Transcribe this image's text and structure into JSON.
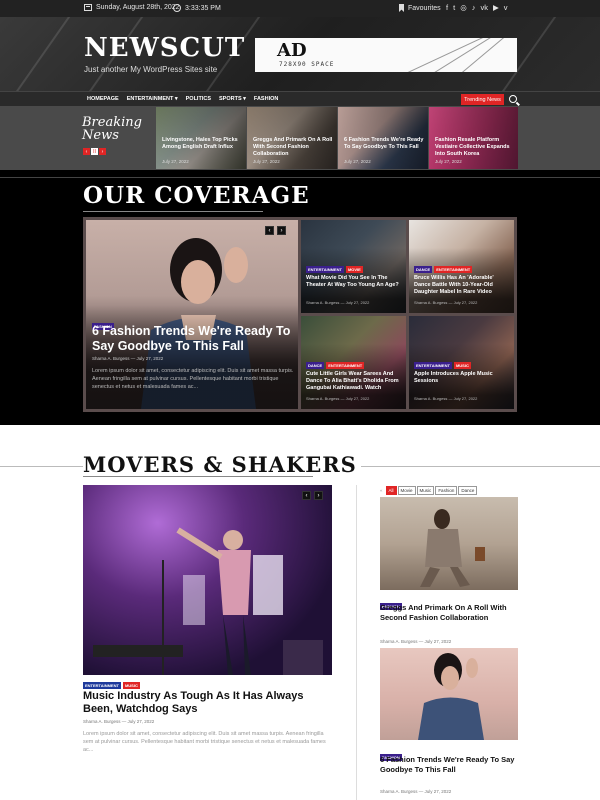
{
  "topbar": {
    "date": "Sunday, August 28th, 2022",
    "time": "3:33:35 PM",
    "favourites": "Favourites",
    "social_icons": [
      "facebook-icon",
      "twitter-icon",
      "instagram-icon",
      "tiktok-icon",
      "vk-icon",
      "youtube-icon",
      "vimeo-icon"
    ],
    "social_glyphs": [
      "f",
      "t",
      "◎",
      "♪",
      "vk",
      "▶",
      "v"
    ]
  },
  "header": {
    "logo": "NEWSCUT",
    "tagline": "Just another My WordPress Sites site",
    "ad_title": "AD",
    "ad_sub": "728X90 SPACE"
  },
  "nav": {
    "items": [
      "HOMEPAGE",
      "ENTERTAINMENT ▾",
      "POLITICS",
      "SPORTS ▾",
      "FASHION"
    ],
    "trending": "Trending News"
  },
  "breaking": {
    "label_line1": "Breaking",
    "label_line2": "News",
    "controls": [
      "‹",
      "II",
      "›"
    ],
    "items": [
      {
        "title": "Livingstone, Hales Top Picks Among English Draft Influx",
        "date": "July 27, 2022"
      },
      {
        "title": "Greggs And Primark On A Roll With Second Fashion Collaboration",
        "date": "July 27, 2022"
      },
      {
        "title": "6 Fashion Trends We're Ready To Say Goodbye To This Fall",
        "date": "July 27, 2022"
      },
      {
        "title": "Fashion Resale Platform Vestiaire Collective Expands Into South Korea",
        "date": "July 27, 2022"
      }
    ]
  },
  "coverage": {
    "title": "OUR COVERAGE",
    "main": {
      "category": "FASHION",
      "title": "6 Fashion Trends We're Ready To Say Goodbye To This Fall",
      "meta": "Sharna A. Burgess  —  July 27, 2022",
      "excerpt": "Lorem ipsum dolor sit amet, consectetur adipiscing elit. Duis sit amet massa turpis. Aenean fringilla sem at pulvinar cursus. Pellentesque habitant morbi tristique senectus et netus et malesuada fames ac..."
    },
    "cards": [
      {
        "cats": [
          "ENTERTAINMENT",
          "MOVIE"
        ],
        "title": "What Movie Did You See In The Theater At Way Too Young An Age?",
        "meta": "Sharna A. Burgess  —  July 27, 2022"
      },
      {
        "cats": [
          "DANCE",
          "ENTERTAINMENT"
        ],
        "title": "Bruce Willis Has An 'Adorable' Dance Battle With 10-Year-Old Daughter Mabel In Rare Video",
        "meta": "Sharna A. Burgess  —  July 27, 2022"
      },
      {
        "cats": [
          "DANCE",
          "ENTERTAINMENT"
        ],
        "title": "Cute Little Girls Wear Sarees And Dance To Alia Bhatt's Dholida From Gangubai Kathiawadi. Watch",
        "meta": "Sharna A. Burgess  —  July 27, 2022"
      },
      {
        "cats": [
          "ENTERTAINMENT",
          "MUSIC"
        ],
        "title": "Apple Introduces Apple Music Sessions",
        "meta": "Sharna A. Burgess  —  July 27, 2022"
      }
    ],
    "arrows": [
      "‹",
      "›"
    ]
  },
  "movers": {
    "title": "MOVERS & SHAKERS",
    "main": {
      "cats": [
        "ENTERTAINMENT",
        "MUSIC"
      ],
      "title": "Music Industry As Tough As It Has Always Been, Watchdog Says",
      "meta": "Sharna A. Burgess  —  July 27, 2022",
      "excerpt": "Lorem ipsum dolor sit amet, consectetur adipiscing elit. Duis sit amet massa turpis. Aenean fringilla sem at pulvinar cursus. Pellentesque habitant morbi tristique senectus et netus et malesuada fames ac..."
    },
    "filter_prefix": "«",
    "filters": [
      "All",
      "Movie",
      "Music",
      "Fashion",
      "Dance"
    ],
    "side": [
      {
        "cat": "FASHION",
        "title": "Greggs And Primark On A Roll With Second Fashion Collaboration",
        "meta": "Sharna A. Burgess  —  July 27, 2022"
      },
      {
        "cat": "FASHION",
        "title": "6 Fashion Trends We're Ready To Say Goodbye To This Fall",
        "meta": "Sharna A. Burgess  —  July 27, 2022"
      }
    ],
    "arrows": [
      "‹",
      "›"
    ]
  },
  "colors": {
    "accent": "#e02525",
    "category_purple": "#3a1f8c",
    "dark_bg": "#000000",
    "header_bg": "#2a2a2a"
  }
}
